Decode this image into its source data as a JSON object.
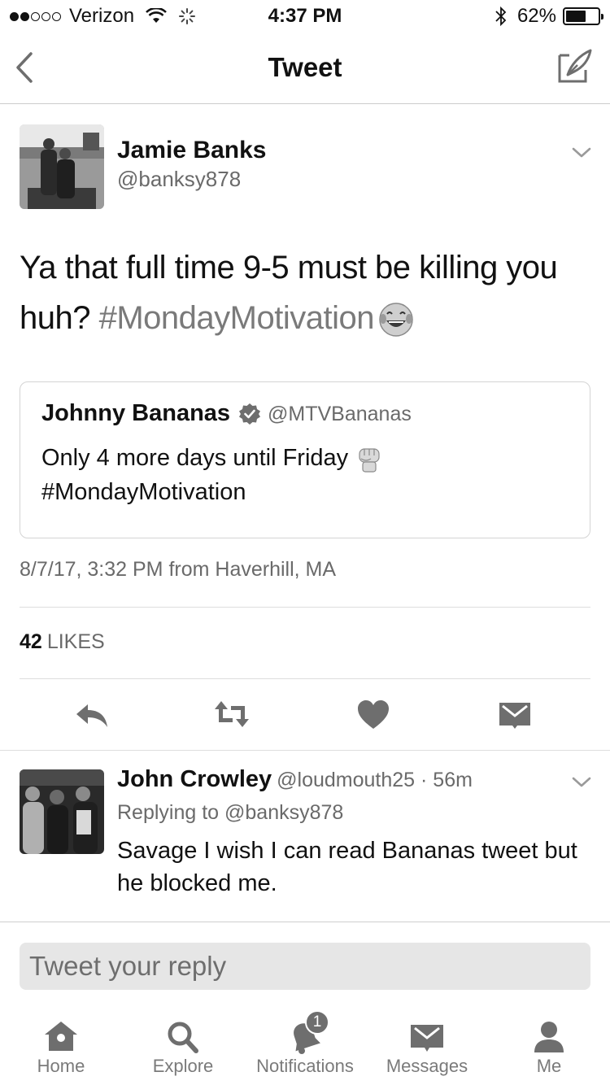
{
  "status_bar": {
    "carrier": "Verizon",
    "time": "4:37 PM",
    "battery": "62%",
    "battery_level": 0.62,
    "signal_bars_filled": 2,
    "signal_bars_total": 5
  },
  "nav": {
    "title": "Tweet",
    "back_icon": "chevron-left-icon",
    "compose_icon": "compose-icon"
  },
  "tweet": {
    "author_name": "Jamie Banks",
    "author_handle": "@banksy878",
    "text_plain": "Ya that full time 9-5 must be killing you huh? ",
    "text_hashtag": "#MondayMotivation",
    "emoji": "😂",
    "timestamp": "8/7/17, 3:32 PM from Haverhill, MA",
    "likes_count": "42",
    "likes_label": "LIKES"
  },
  "quoted_tweet": {
    "author_name": "Johnny Bananas",
    "author_handle": "@MTVBananas",
    "text": "Only 4 more days until Friday ",
    "emoji": "✊",
    "hashtag": "#MondayMotivation"
  },
  "actions": [
    "reply-icon",
    "retweet-icon",
    "heart-icon",
    "envelope-icon"
  ],
  "reply": {
    "author_name": "John Crowley",
    "author_handle": "@loudmouth25 · 56m",
    "replying_to": "Replying to @banksy878",
    "text": "Savage I wish I can read Bananas tweet but he blocked me."
  },
  "composer": {
    "placeholder": "Tweet your reply"
  },
  "tabs": [
    {
      "label": "Home",
      "icon": "home-icon"
    },
    {
      "label": "Explore",
      "icon": "search-icon"
    },
    {
      "label": "Notifications",
      "icon": "bell-icon",
      "badge": "1"
    },
    {
      "label": "Messages",
      "icon": "envelope-icon"
    },
    {
      "label": "Me",
      "icon": "person-icon"
    }
  ],
  "colors": {
    "text": "#111111",
    "secondary": "#6a6a6a",
    "icon": "#6e6e6e",
    "divider": "#dedede"
  }
}
